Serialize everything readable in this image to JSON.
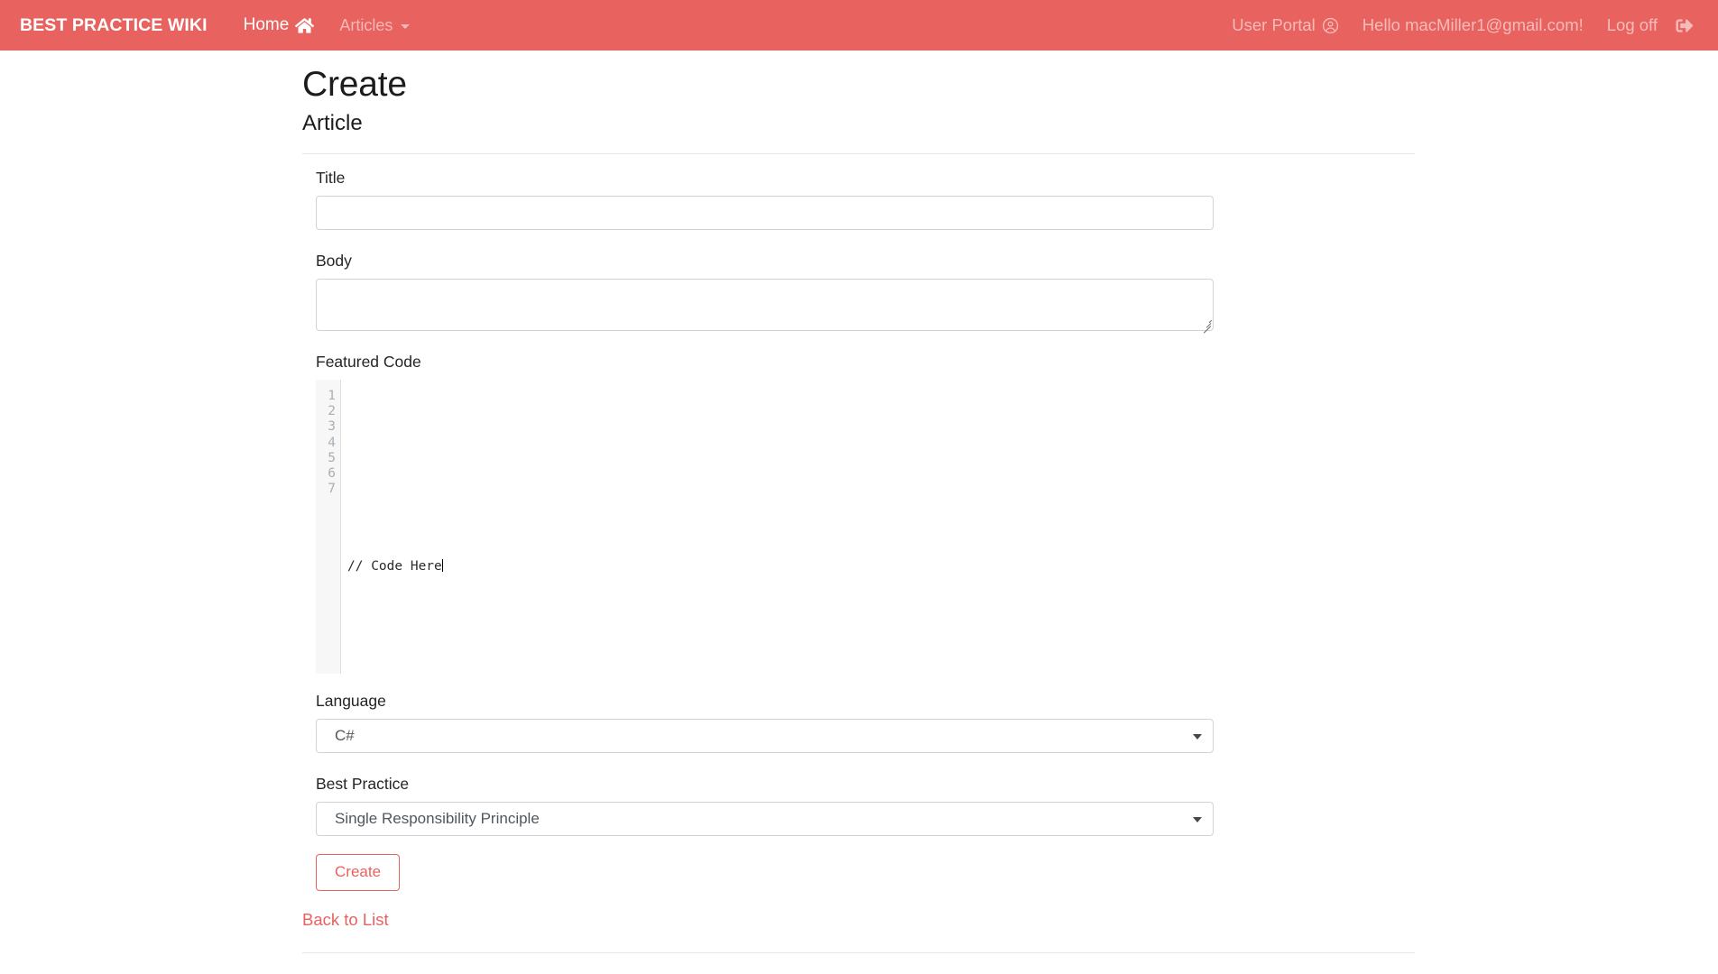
{
  "navbar": {
    "brand": "BEST PRACTICE WIKI",
    "left_items": [
      {
        "label": "Home",
        "icon": "home-icon"
      },
      {
        "label": "Articles",
        "icon": "chevron-down-icon"
      }
    ],
    "right_items": [
      {
        "label": "User Portal",
        "icon": "user-circle-icon"
      },
      {
        "label": "Hello macMiller1@gmail.com!",
        "icon": null
      },
      {
        "label": "Log off",
        "icon": "logout-icon"
      }
    ],
    "background_color": "#e8625f",
    "brand_color": "#ffffff",
    "muted_link_color": "#f5b8b5"
  },
  "page": {
    "title": "Create",
    "subtitle": "Article"
  },
  "form": {
    "title_field": {
      "label": "Title",
      "value": "",
      "placeholder": ""
    },
    "body_field": {
      "label": "Body",
      "value": "",
      "placeholder": ""
    },
    "featured_code": {
      "label": "Featured Code",
      "line_numbers": [
        "1",
        "2",
        "3",
        "4",
        "5",
        "6",
        "7"
      ],
      "lines": [
        "",
        "",
        "",
        "// Code Here",
        "",
        "",
        ""
      ],
      "cursor_line": 4
    },
    "language_field": {
      "label": "Language",
      "value": "C#",
      "options": [
        "C#"
      ]
    },
    "best_practice_field": {
      "label": "Best Practice",
      "value": "Single Responsibility Principle",
      "options": [
        "Single Responsibility Principle"
      ]
    },
    "submit_button": "Create",
    "back_link": "Back to List",
    "accent_color": "#e8625f"
  }
}
